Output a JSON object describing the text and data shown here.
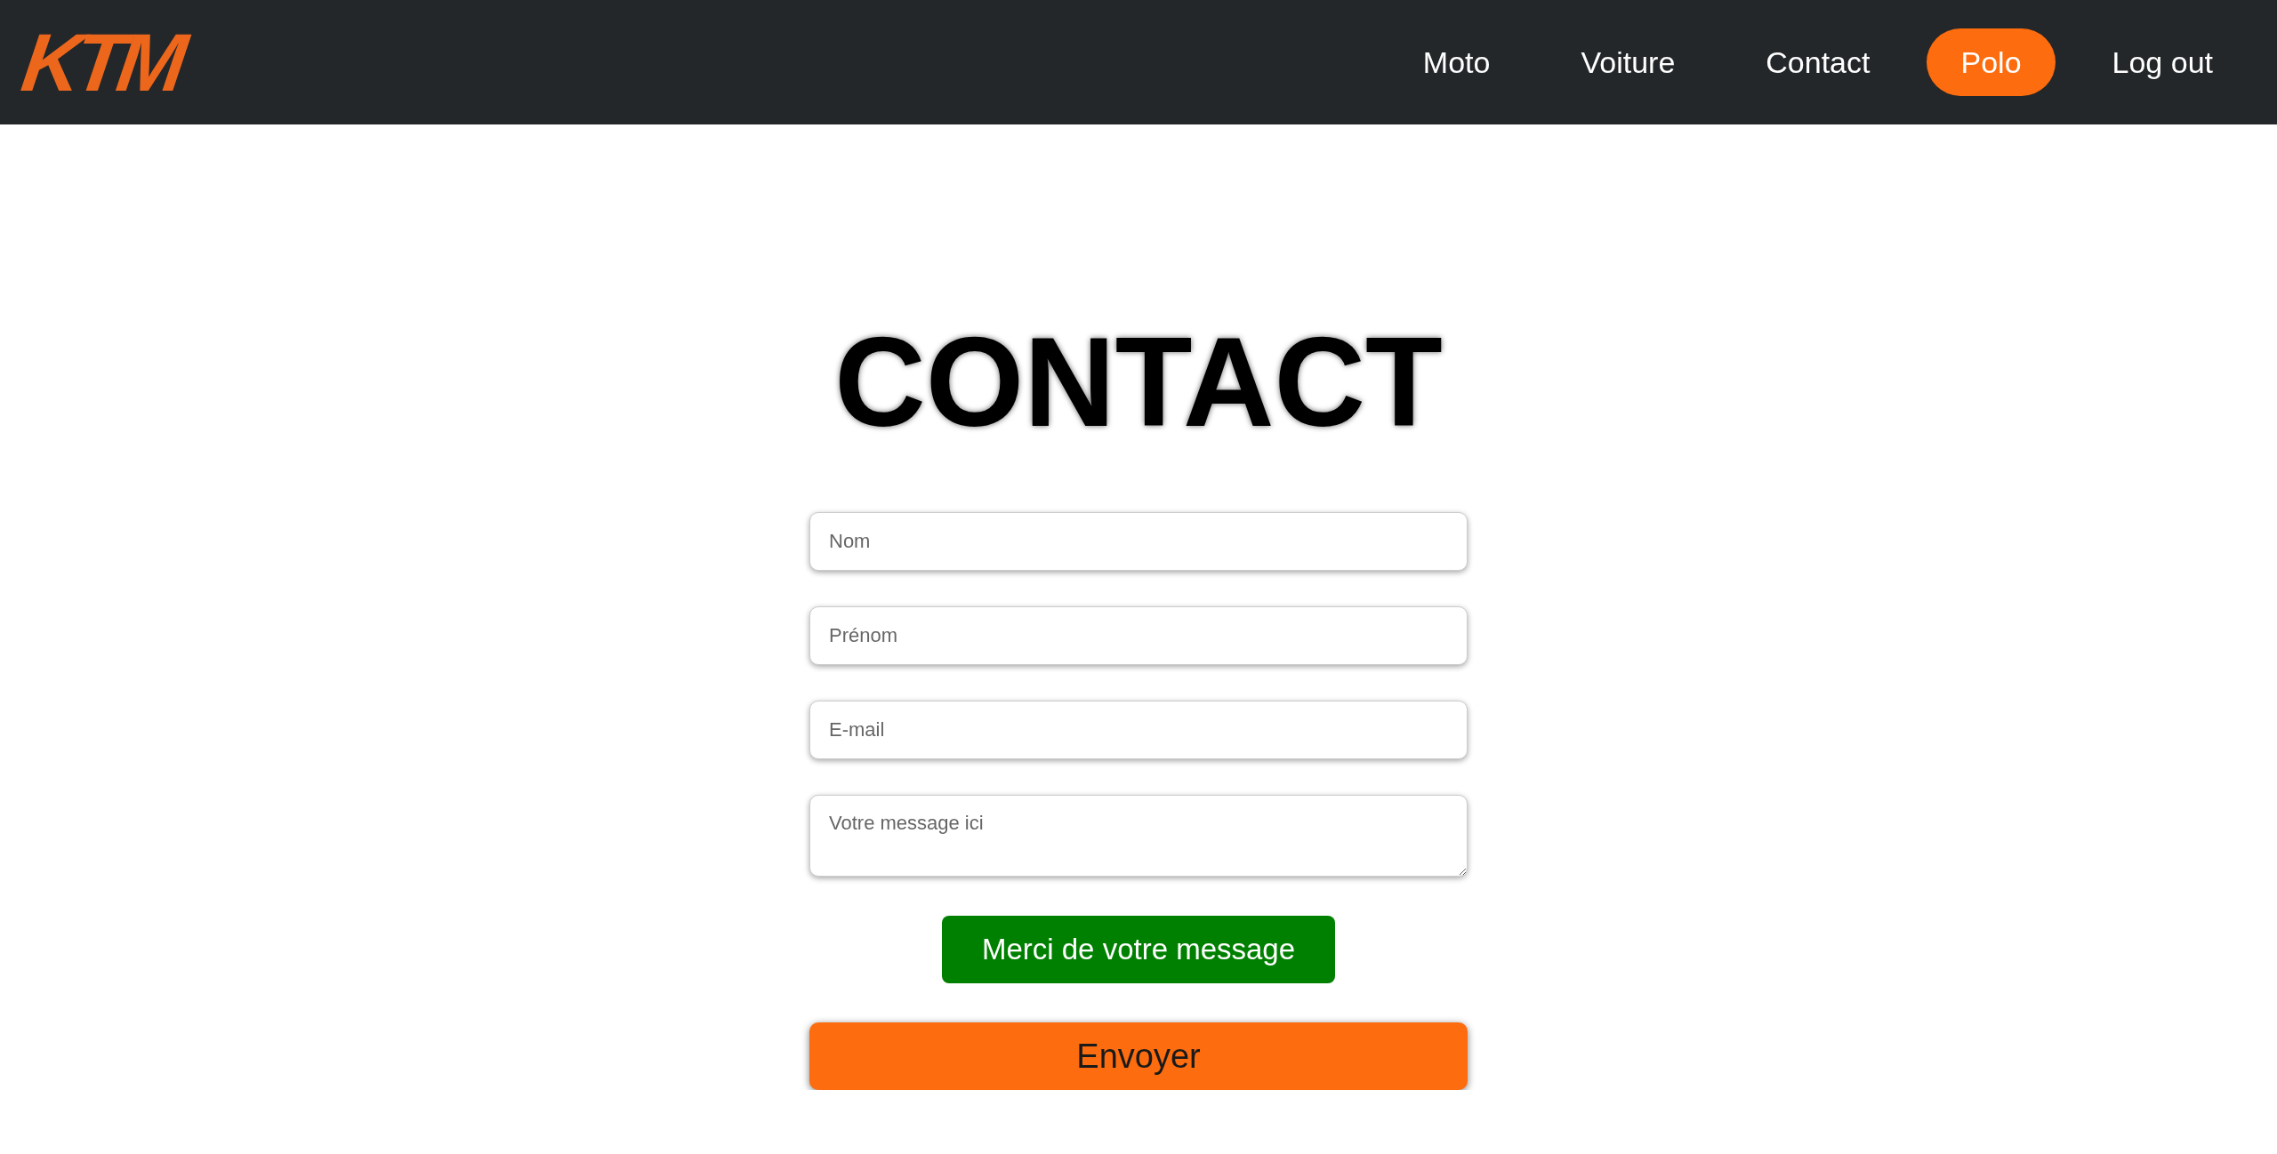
{
  "navbar": {
    "logo": "KTM",
    "links": [
      {
        "label": "Moto",
        "selected": false
      },
      {
        "label": "Voiture",
        "selected": false
      },
      {
        "label": "Contact",
        "selected": false
      },
      {
        "label": "Polo",
        "selected": true
      },
      {
        "label": "Log out",
        "selected": false
      }
    ]
  },
  "title": "CONTACT",
  "form": {
    "fields": [
      {
        "kind": "input",
        "placeholder": "Nom"
      },
      {
        "kind": "input",
        "placeholder": "Prénom"
      },
      {
        "kind": "input",
        "placeholder": "E-mail"
      },
      {
        "kind": "textarea",
        "placeholder": "Votre message ici"
      }
    ],
    "success_message": "Merci de votre message",
    "submit": "Envoyer"
  }
}
